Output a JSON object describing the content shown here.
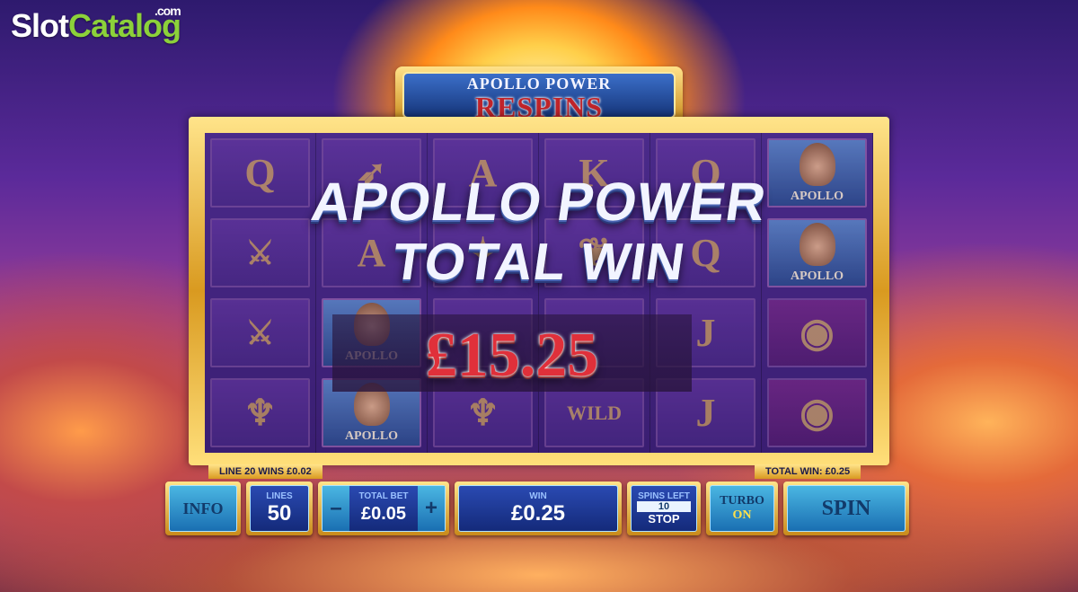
{
  "watermark": {
    "brand_a": "Slot",
    "brand_b": "Catalog",
    "suffix": ".com"
  },
  "title_banner": {
    "line1": "APOLLO POWER",
    "line2": "RESPINS"
  },
  "overlay": {
    "line1": "APOLLO POWER",
    "line2": "TOTAL WIN",
    "amount": "£15.25"
  },
  "reels": {
    "columns": [
      [
        "Q",
        "sword",
        "sword",
        "lyre"
      ],
      [
        "bow",
        "A",
        "apollo",
        "apollo"
      ],
      [
        "A",
        "star",
        "",
        "lyre"
      ],
      [
        "K",
        "laurel",
        "",
        "WILD"
      ],
      [
        "Q",
        "Q",
        "J",
        "J"
      ],
      [
        "apollo",
        "apollo",
        "ring",
        "ring"
      ]
    ],
    "apollo_label": "APOLLO"
  },
  "info_line": {
    "left": "LINE 20 WINS £0.02",
    "right": "TOTAL WIN: £0.25"
  },
  "controls": {
    "info_label": "INFO",
    "lines": {
      "label": "LINES",
      "value": "50"
    },
    "minus_label": "–",
    "total_bet": {
      "label": "TOTAL BET",
      "value": "£0.05"
    },
    "plus_label": "+",
    "win": {
      "label": "WIN",
      "value": "£0.25"
    },
    "spins_left": {
      "label": "SPINS LEFT",
      "value": "10",
      "stop_label": "STOP"
    },
    "turbo": {
      "label": "TURBO",
      "state": "ON"
    },
    "spin_label": "SPIN"
  },
  "colors": {
    "gold": "#ffe48a",
    "accent_blue": "#1a6fb2",
    "win_red": "#e0303a"
  }
}
